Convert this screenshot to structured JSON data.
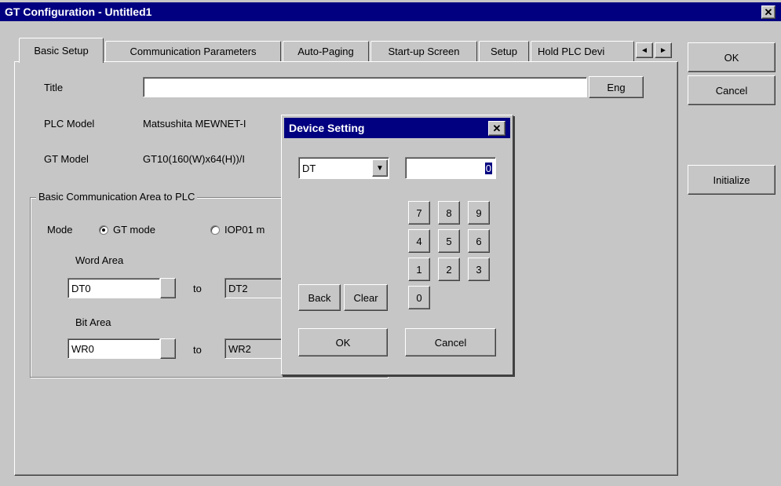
{
  "window": {
    "title": "GT Configuration - Untitled1",
    "close_glyph": "✕"
  },
  "tabs": [
    {
      "label": "Basic Setup",
      "active": true
    },
    {
      "label": "Communication Parameters"
    },
    {
      "label": "Auto-Paging"
    },
    {
      "label": "Start-up Screen"
    },
    {
      "label": "Setup"
    },
    {
      "label": "Hold PLC Devi"
    }
  ],
  "tab_scroll": {
    "left_icon": "◄",
    "right_icon": "►"
  },
  "right_buttons": {
    "ok": "OK",
    "cancel": "Cancel",
    "initialize": "Initialize"
  },
  "basic_setup": {
    "title_label": "Title",
    "title_value": "",
    "eng_button": "Eng",
    "plc_model_label": "PLC Model",
    "plc_model_value": "Matsushita MEWNET-I",
    "gt_model_label": "GT Model",
    "gt_model_value": "GT10(160(W)x64(H))/I",
    "group_label": "Basic Communication Area to PLC",
    "mode_label": "Mode",
    "mode_gt": "GT mode",
    "mode_iop": "IOP01 m",
    "mode_selected": "GT mode",
    "word_area_label": "Word Area",
    "word_from": "DT0",
    "word_to": "DT2",
    "bit_area_label": "Bit Area",
    "bit_from": "WR0",
    "bit_to": "WR2",
    "to_label": "to"
  },
  "device_dialog": {
    "title": "Device Setting",
    "close_glyph": "✕",
    "device_type": "DT",
    "device_number": "0",
    "keys_row1": [
      "7",
      "8",
      "9"
    ],
    "keys_row2": [
      "4",
      "5",
      "6"
    ],
    "keys_row3": [
      "1",
      "2",
      "3"
    ],
    "key_zero": "0",
    "back": "Back",
    "clear": "Clear",
    "ok": "OK",
    "cancel": "Cancel"
  },
  "colors": {
    "face": "#c6c6c6",
    "titlebar": "#000080",
    "highlight": "#000080"
  }
}
